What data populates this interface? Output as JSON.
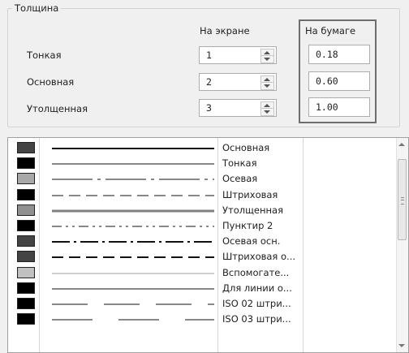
{
  "thickness": {
    "group_title": "Толщина",
    "col_screen": "На экране",
    "col_paper": "На бумаге",
    "rows": [
      {
        "label": "Тонкая",
        "screen": "1",
        "paper": "0.18"
      },
      {
        "label": "Основная",
        "screen": "2",
        "paper": "0.60"
      },
      {
        "label": "Утолщенная",
        "screen": "3",
        "paper": "1.00"
      }
    ]
  },
  "line_styles": [
    {
      "name": "Основная",
      "color": "#444444",
      "pattern": "solid",
      "weight": "main"
    },
    {
      "name": "Тонкая",
      "color": "#000000",
      "pattern": "solid",
      "weight": "thin"
    },
    {
      "name": "Осевая",
      "color": "#a8a8a8",
      "pattern": "dash-dot-long",
      "weight": "thin"
    },
    {
      "name": "Штриховая",
      "color": "#000000",
      "pattern": "dashed",
      "weight": "thin"
    },
    {
      "name": "Утолщенная",
      "color": "#909090",
      "pattern": "solid",
      "weight": "thick"
    },
    {
      "name": "Пунктир 2",
      "color": "#000000",
      "pattern": "dash-dot-dot",
      "weight": "thin"
    },
    {
      "name": "Осевая осн.",
      "color": "#444444",
      "pattern": "dash-dot",
      "weight": "main"
    },
    {
      "name": "Штриховая о...",
      "color": "#444444",
      "pattern": "dashed",
      "weight": "main"
    },
    {
      "name": "Вспомогате...",
      "color": "#c0c0c0",
      "pattern": "solid",
      "weight": "thin"
    },
    {
      "name": "Для линии о...",
      "color": "#000000",
      "pattern": "solid",
      "weight": "thin"
    },
    {
      "name": "ISO 02 штри...",
      "color": "#000000",
      "pattern": "long-dash",
      "weight": "thin"
    },
    {
      "name": "ISO 03 штри...",
      "color": "#000000",
      "pattern": "long-dash-gap",
      "weight": "thin"
    }
  ]
}
